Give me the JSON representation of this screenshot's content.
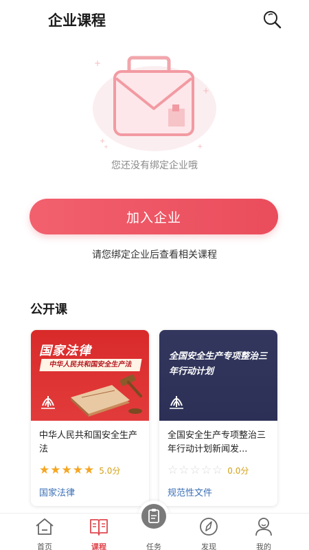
{
  "header": {
    "title": "企业课程",
    "search_icon": "search-icon"
  },
  "empty_state": {
    "illustration": "briefcase-illustration",
    "message": "您还没有绑定企业哦",
    "join_button_label": "加入企业",
    "hint": "请您绑定企业后查看相关课程"
  },
  "public_courses": {
    "section_title": "公开课",
    "cards": [
      {
        "thumb_heading": "国家法律",
        "thumb_banner": "中华人民共和国安全生产法",
        "title": "中华人民共和国安全生产法",
        "rating": 5,
        "rating_max": 5,
        "score": "5.0分",
        "tag": "国家法律"
      },
      {
        "thumb_heading": "全国安全生产专项整治三年行动计划",
        "title": "全国安全生产专项整治三年行动计划新闻发...",
        "rating": 0,
        "rating_max": 5,
        "score": "0.0分",
        "tag": "规范性文件"
      }
    ]
  },
  "tabbar": {
    "active": "课程",
    "accent_color": "#e0474e",
    "items": [
      {
        "label": "首页",
        "icon": "home-icon"
      },
      {
        "label": "课程",
        "icon": "book-icon"
      },
      {
        "label": "任务",
        "icon": "clipboard-icon"
      },
      {
        "label": "发现",
        "icon": "compass-icon"
      },
      {
        "label": "我的",
        "icon": "user-icon"
      }
    ]
  }
}
